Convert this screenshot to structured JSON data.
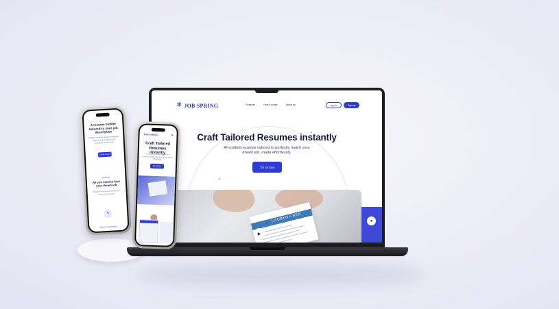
{
  "colors": {
    "brand_blue": "#2f3bd1",
    "logo_blue": "#2c3aa6",
    "heading": "#151a38",
    "body_text": "#3a3f5c",
    "background": "#eeeef8"
  },
  "laptop": {
    "logo": {
      "icon": "snowflake-logo-icon",
      "text": "JOB SPRING"
    },
    "nav": {
      "links": [
        "Features",
        "How it works",
        "About us"
      ],
      "signin_label": "sign in",
      "signup_label": "Sign up"
    },
    "hero": {
      "title": "Craft Tailored Resumes instantly",
      "subtitle": "AI-crafted resumes tailored to perfectly match your dream job, made effortlessly.",
      "cta_label": "Try for free"
    },
    "media": {
      "resume_name": "LAUREN CHEN",
      "play_icon": "play-icon",
      "chat_icon": "chat-bubble-icon"
    }
  },
  "phone_left": {
    "hero_title": "A resume builder tailored to your job description",
    "hero_text": "Craft AI-powered resume templates, tailored to your dream job description in seconds.",
    "cta_label": "Create resume",
    "section_tag": "Features",
    "section_title": "All you need to land your dream job",
    "section_text": "Discover all the tools that help you land your dream job.",
    "feature_icon": "lightning-icon",
    "feature_label": "Speed customization"
  },
  "phone_right": {
    "logo_text": "JOB SPRING",
    "menu_icon": "hamburger-menu-icon",
    "hero_title": "Craft Tailored Resumes instantly",
    "hero_text": "AI-crafted resumes tailored to perfectly match your dream job, made effortlessly.",
    "cta_label": "Try for free"
  }
}
